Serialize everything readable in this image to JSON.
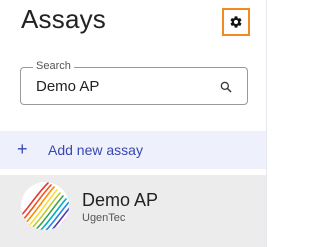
{
  "header": {
    "title": "Assays",
    "settings_icon": "gear-icon",
    "highlight_color": "#f18b1d"
  },
  "search": {
    "label": "Search",
    "value": "Demo AP",
    "icon": "search-icon"
  },
  "add_assay": {
    "icon": "plus-icon",
    "label": "Add new assay",
    "color": "#3747b3"
  },
  "assays": [
    {
      "name": "Demo AP",
      "organization": "UgenTec",
      "logo": "ugentec-logo",
      "selected": true
    }
  ]
}
